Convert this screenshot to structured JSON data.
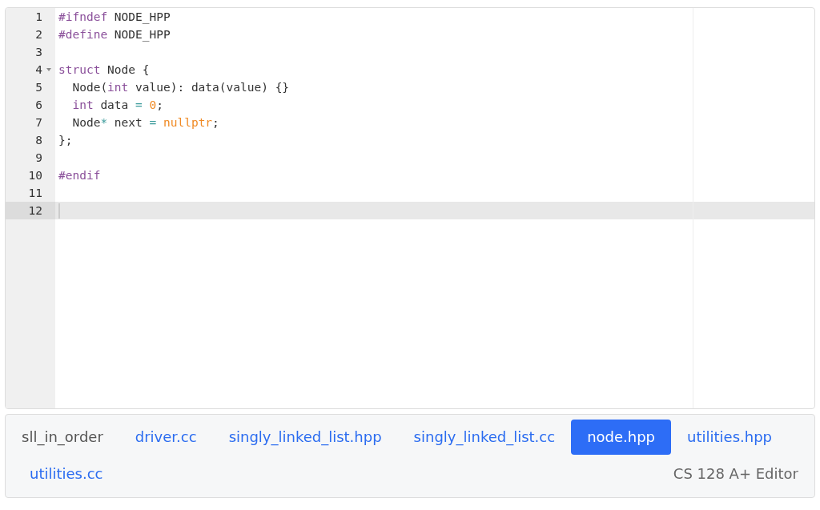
{
  "editor": {
    "lines": [
      {
        "number": "1",
        "active": false,
        "foldable": false,
        "tokens": [
          {
            "kind": "meta",
            "text": "#ifndef"
          },
          {
            "kind": "plain",
            "text": " NODE_HPP"
          }
        ]
      },
      {
        "number": "2",
        "active": false,
        "foldable": false,
        "tokens": [
          {
            "kind": "meta",
            "text": "#define"
          },
          {
            "kind": "plain",
            "text": " NODE_HPP"
          }
        ]
      },
      {
        "number": "3",
        "active": false,
        "foldable": false
      },
      {
        "number": "4",
        "active": false,
        "foldable": true,
        "tokens": [
          {
            "kind": "keyword",
            "text": "struct"
          },
          {
            "kind": "plain",
            "text": " Node {"
          }
        ]
      },
      {
        "number": "5",
        "active": false,
        "foldable": false,
        "tokens": [
          {
            "kind": "plain",
            "text": "  Node("
          },
          {
            "kind": "keyword",
            "text": "int"
          },
          {
            "kind": "plain",
            "text": " value): data(value) {}"
          }
        ]
      },
      {
        "number": "6",
        "active": false,
        "foldable": false,
        "tokens": [
          {
            "kind": "keyword",
            "text": "  int"
          },
          {
            "kind": "plain",
            "text": " data "
          },
          {
            "kind": "operator",
            "text": "= "
          },
          {
            "kind": "number",
            "text": "0"
          },
          {
            "kind": "plain",
            "text": ";"
          }
        ]
      },
      {
        "number": "7",
        "active": false,
        "foldable": false,
        "tokens": [
          {
            "kind": "plain",
            "text": "  Node"
          },
          {
            "kind": "operator",
            "text": "*"
          },
          {
            "kind": "plain",
            "text": " next "
          },
          {
            "kind": "operator",
            "text": "= "
          },
          {
            "kind": "number",
            "text": "nullptr"
          },
          {
            "kind": "plain",
            "text": ";"
          }
        ]
      },
      {
        "number": "8",
        "active": false,
        "foldable": false,
        "tokens": [
          {
            "kind": "plain",
            "text": "};"
          }
        ]
      },
      {
        "number": "9",
        "active": false,
        "foldable": false
      },
      {
        "number": "10",
        "active": false,
        "foldable": false,
        "tokens": [
          {
            "kind": "meta",
            "text": "#endif"
          }
        ]
      },
      {
        "number": "11",
        "active": false,
        "foldable": false
      },
      {
        "number": "12",
        "active": true,
        "foldable": false
      }
    ]
  },
  "nav": {
    "project": "sll_in_order",
    "tabs": [
      {
        "label": "driver.cc",
        "selected": false
      },
      {
        "label": "singly_linked_list.hpp",
        "selected": false
      },
      {
        "label": "singly_linked_list.cc",
        "selected": false
      },
      {
        "label": "node.hpp",
        "selected": true
      },
      {
        "label": "utilities.hpp",
        "selected": false
      },
      {
        "label": "utilities.cc",
        "selected": false
      }
    ],
    "brand": "CS 128 A+ Editor"
  }
}
